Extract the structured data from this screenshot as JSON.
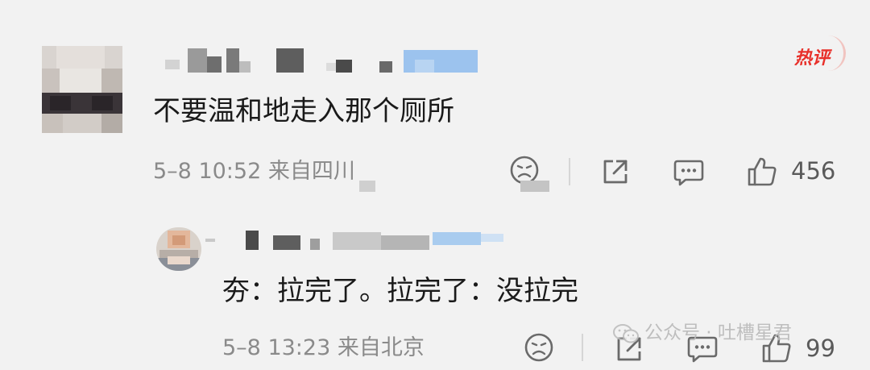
{
  "badge": "热评",
  "comment": {
    "text": "不要温和地走入那个厕所",
    "meta": "5–8 10:52  来自四川",
    "like_count": "456"
  },
  "reply": {
    "text": "夯：拉完了。拉完了：没拉完",
    "meta": "5–8 13:23  来自北京",
    "like_count": "99"
  },
  "watermark": "公众号 · 吐槽星君",
  "colors": {
    "background": "#f2f2f2",
    "badge": "#e8302a",
    "text": "#1a1a1a",
    "meta": "#8a8a8a"
  },
  "icons": [
    "sad-face-icon",
    "share-icon",
    "comment-icon",
    "thumbs-up-icon",
    "wechat-icon"
  ]
}
